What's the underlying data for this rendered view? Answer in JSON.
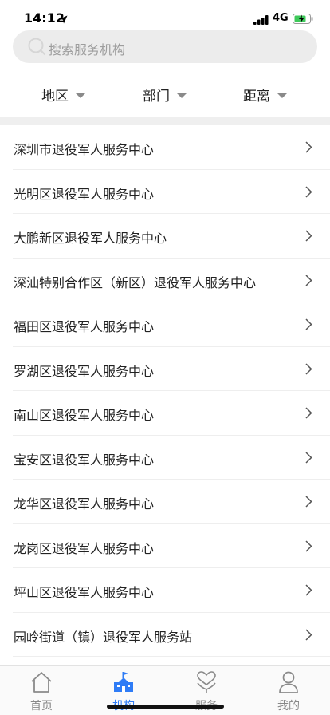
{
  "status": {
    "time": "14:12",
    "network": "4G"
  },
  "search": {
    "placeholder": "搜索服务机构"
  },
  "filters": [
    "地区",
    "部门",
    "距离"
  ],
  "organizations": [
    "深圳市退役军人服务中心",
    "光明区退役军人服务中心",
    "大鹏新区退役军人服务中心",
    "深汕特别合作区（新区）退役军人服务中心",
    "福田区退役军人服务中心",
    "罗湖区退役军人服务中心",
    "南山区退役军人服务中心",
    "宝安区退役军人服务中心",
    "龙华区退役军人服务中心",
    "龙岗区退役军人服务中心",
    "坪山区退役军人服务中心",
    "园岭街道（镇）退役军人服务站"
  ],
  "tabs": [
    {
      "label": "首页",
      "icon": "home-icon"
    },
    {
      "label": "机构",
      "icon": "building-icon"
    },
    {
      "label": "服务",
      "icon": "heart-hand-icon"
    },
    {
      "label": "我的",
      "icon": "person-icon"
    }
  ],
  "active_tab": 1,
  "colors": {
    "accent": "#2f7cf6"
  }
}
